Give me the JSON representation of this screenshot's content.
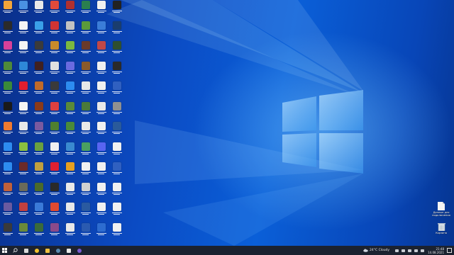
{
  "desktop": {
    "wallpaper": "windows-10-hero",
    "accent_color": "#0a5fd8"
  },
  "desktop_icons": [
    {
      "color": "#f2a53a"
    },
    {
      "color": "#4a90e2"
    },
    {
      "color": "#e8e8e8"
    },
    {
      "color": "#e04a3a"
    },
    {
      "color": "#b03030"
    },
    {
      "color": "#2a7f4f"
    },
    {
      "color": "#f0f0f0"
    },
    {
      "color": "#222222"
    },
    {
      "color": "#2b2b2b"
    },
    {
      "color": "#f4f4f4"
    },
    {
      "color": "#3aa0e8"
    },
    {
      "color": "#d03434"
    },
    {
      "color": "#c2c2c2"
    },
    {
      "color": "#5b9b3a"
    },
    {
      "color": "#3b7dd8"
    },
    {
      "color": "#1a3d6e"
    },
    {
      "color": "#d8409a"
    },
    {
      "color": "#f4f4f4"
    },
    {
      "color": "#3b3b3b"
    },
    {
      "color": "#c88a2a"
    },
    {
      "color": "#7bb840"
    },
    {
      "color": "#6a3a2a"
    },
    {
      "color": "#c04848"
    },
    {
      "color": "#2f4f2f"
    },
    {
      "color": "#4f8a3a"
    },
    {
      "color": "#2e88d8"
    },
    {
      "color": "#402020"
    },
    {
      "color": "#e0e0e0"
    },
    {
      "color": "#6a6ae0"
    },
    {
      "color": "#8a5a2a"
    },
    {
      "color": "#f0f0f0"
    },
    {
      "color": "#2a2a2a"
    },
    {
      "color": "#3a8a3a"
    },
    {
      "color": "#e01e2e"
    },
    {
      "color": "#c06a2a"
    },
    {
      "color": "#3a3a3a"
    },
    {
      "color": "#2d8cf0"
    },
    {
      "color": "#e8e8e8"
    },
    {
      "color": "#f0f0f0"
    },
    {
      "color": "#3060c0"
    },
    {
      "color": "#1a1a1a"
    },
    {
      "color": "#f4f4f4"
    },
    {
      "color": "#8a3a1a"
    },
    {
      "color": "#e04040"
    },
    {
      "color": "#5a8a3a"
    },
    {
      "color": "#4a7a3a"
    },
    {
      "color": "#e8e8e8"
    },
    {
      "color": "#909090"
    },
    {
      "color": "#f07a30"
    },
    {
      "color": "#e8e8e8"
    },
    {
      "color": "#7a5aa0"
    },
    {
      "color": "#4f7f2f"
    },
    {
      "color": "#4a8a3a"
    },
    {
      "color": "#e8e8e8"
    },
    {
      "color": "#f0f0f0"
    },
    {
      "color": "#2a5a9a"
    },
    {
      "color": "#2d8cf0"
    },
    {
      "color": "#8ac040"
    },
    {
      "color": "#6aa040"
    },
    {
      "color": "#f0f0f0"
    },
    {
      "color": "#3a8ad0"
    },
    {
      "color": "#4aa060"
    },
    {
      "color": "#5865f2"
    },
    {
      "color": "#f0f0f0"
    },
    {
      "color": "#2d8cf0"
    },
    {
      "color": "#6a2a2a"
    },
    {
      "color": "#c0a040"
    },
    {
      "color": "#e02030"
    },
    {
      "color": "#e8a020"
    },
    {
      "color": "#f0f0f0"
    },
    {
      "color": "#f0f0f0"
    },
    {
      "color": "#3060c0"
    },
    {
      "color": "#c0603a"
    },
    {
      "color": "#6a6a5a"
    },
    {
      "color": "#4a6a2a"
    },
    {
      "color": "#2a2a2a"
    },
    {
      "color": "#e8e8e8"
    },
    {
      "color": "#d0d0d0"
    },
    {
      "color": "#f0f0f0"
    },
    {
      "color": "#f0f0f0"
    },
    {
      "color": "#6a5aa0"
    },
    {
      "color": "#c04040"
    },
    {
      "color": "#3a7ad8"
    },
    {
      "color": "#e04a30"
    },
    {
      "color": "#e8e8e8"
    },
    {
      "color": "#2a5aa0"
    },
    {
      "color": "#f0f0f0"
    },
    {
      "color": "#f0f0f0"
    },
    {
      "color": "#3a3a3a"
    },
    {
      "color": "#6a8a3a"
    },
    {
      "color": "#3a6a3a"
    },
    {
      "color": "#8a4a8a"
    },
    {
      "color": "#e8e8e8"
    },
    {
      "color": "#2a5ab0"
    },
    {
      "color": "#2d6cd0"
    },
    {
      "color": "#f0f0f0"
    }
  ],
  "right_icons": [
    {
      "label_line1": "Данные для",
      "label_line2": "подключения",
      "icon": "document-icon"
    },
    {
      "label_line1": "Корзина",
      "label_line2": "",
      "icon": "recycle-bin-icon"
    }
  ],
  "taskbar": {
    "apps": [
      {
        "name": "task-view",
        "color": "#d8d8d8"
      },
      {
        "name": "chrome",
        "color": "#f2c12e"
      },
      {
        "name": "explorer",
        "color": "#f0c040"
      },
      {
        "name": "steam",
        "color": "#5a8ab0"
      },
      {
        "name": "app",
        "color": "#e8e8e8"
      },
      {
        "name": "obs",
        "color": "#7a5ad0"
      }
    ],
    "weather": "24°C Cloudy",
    "time": "21:48",
    "date": "14.08.2021"
  }
}
